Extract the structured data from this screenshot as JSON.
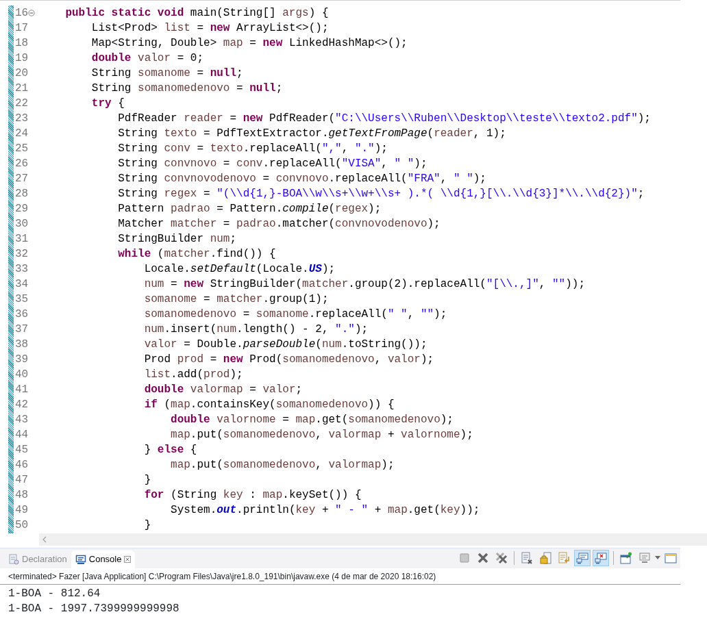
{
  "editor": {
    "lines": [
      {
        "number": "16",
        "fold": true,
        "tokens": [
          {
            "kind": "keyword",
            "text": "    public static void"
          },
          {
            "kind": "plain",
            "text": " main(String[] "
          },
          {
            "kind": "local",
            "text": "args"
          },
          {
            "kind": "plain",
            "text": ") {"
          }
        ]
      },
      {
        "number": "17",
        "fold": false,
        "tokens": [
          {
            "kind": "plain",
            "text": "        List<Prod> "
          },
          {
            "kind": "local",
            "text": "list"
          },
          {
            "kind": "plain",
            "text": " = "
          },
          {
            "kind": "keyword",
            "text": "new"
          },
          {
            "kind": "plain",
            "text": " ArrayList<>();"
          }
        ]
      },
      {
        "number": "18",
        "fold": false,
        "tokens": [
          {
            "kind": "plain",
            "text": "        Map<String, Double> "
          },
          {
            "kind": "local",
            "text": "map"
          },
          {
            "kind": "plain",
            "text": " = "
          },
          {
            "kind": "keyword",
            "text": "new"
          },
          {
            "kind": "plain",
            "text": " LinkedHashMap<>();"
          }
        ]
      },
      {
        "number": "19",
        "fold": false,
        "tokens": [
          {
            "kind": "keyword",
            "text": "        double "
          },
          {
            "kind": "local",
            "text": "valor"
          },
          {
            "kind": "plain",
            "text": " = 0;"
          }
        ]
      },
      {
        "number": "20",
        "fold": false,
        "tokens": [
          {
            "kind": "plain",
            "text": "        String "
          },
          {
            "kind": "local",
            "text": "somanome"
          },
          {
            "kind": "plain",
            "text": " = "
          },
          {
            "kind": "keyword",
            "text": "null"
          },
          {
            "kind": "plain",
            "text": ";"
          }
        ]
      },
      {
        "number": "21",
        "fold": false,
        "tokens": [
          {
            "kind": "plain",
            "text": "        String "
          },
          {
            "kind": "local",
            "text": "somanomedenovo"
          },
          {
            "kind": "plain",
            "text": " = "
          },
          {
            "kind": "keyword",
            "text": "null"
          },
          {
            "kind": "plain",
            "text": ";"
          }
        ]
      },
      {
        "number": "22",
        "fold": false,
        "tokens": [
          {
            "kind": "keyword",
            "text": "        try"
          },
          {
            "kind": "plain",
            "text": " {"
          }
        ]
      },
      {
        "number": "23",
        "fold": false,
        "tokens": [
          {
            "kind": "plain",
            "text": "            PdfReader "
          },
          {
            "kind": "local",
            "text": "reader"
          },
          {
            "kind": "plain",
            "text": " = "
          },
          {
            "kind": "keyword",
            "text": "new"
          },
          {
            "kind": "plain",
            "text": " PdfReader("
          },
          {
            "kind": "string",
            "text": "\"C:\\\\Users\\\\Ruben\\\\Desktop\\\\teste\\\\texto2.pdf\""
          },
          {
            "kind": "plain",
            "text": ");"
          }
        ]
      },
      {
        "number": "24",
        "fold": false,
        "tokens": [
          {
            "kind": "plain",
            "text": "            String "
          },
          {
            "kind": "local",
            "text": "texto"
          },
          {
            "kind": "plain",
            "text": " = PdfTextExtractor."
          },
          {
            "kind": "static",
            "text": "getTextFromPage"
          },
          {
            "kind": "plain",
            "text": "("
          },
          {
            "kind": "local",
            "text": "reader"
          },
          {
            "kind": "plain",
            "text": ", 1);"
          }
        ]
      },
      {
        "number": "25",
        "fold": false,
        "tokens": [
          {
            "kind": "plain",
            "text": "            String "
          },
          {
            "kind": "local",
            "text": "conv"
          },
          {
            "kind": "plain",
            "text": " = "
          },
          {
            "kind": "local",
            "text": "texto"
          },
          {
            "kind": "plain",
            "text": ".replaceAll("
          },
          {
            "kind": "string",
            "text": "\",\""
          },
          {
            "kind": "plain",
            "text": ", "
          },
          {
            "kind": "string",
            "text": "\".\""
          },
          {
            "kind": "plain",
            "text": ");"
          }
        ]
      },
      {
        "number": "26",
        "fold": false,
        "tokens": [
          {
            "kind": "plain",
            "text": "            String "
          },
          {
            "kind": "local",
            "text": "convnovo"
          },
          {
            "kind": "plain",
            "text": " = "
          },
          {
            "kind": "local",
            "text": "conv"
          },
          {
            "kind": "plain",
            "text": ".replaceAll("
          },
          {
            "kind": "string",
            "text": "\"VISA\""
          },
          {
            "kind": "plain",
            "text": ", "
          },
          {
            "kind": "string",
            "text": "\" \""
          },
          {
            "kind": "plain",
            "text": ");"
          }
        ]
      },
      {
        "number": "27",
        "fold": false,
        "tokens": [
          {
            "kind": "plain",
            "text": "            String "
          },
          {
            "kind": "local",
            "text": "convnovodenovo"
          },
          {
            "kind": "plain",
            "text": " = "
          },
          {
            "kind": "local",
            "text": "convnovo"
          },
          {
            "kind": "plain",
            "text": ".replaceAll("
          },
          {
            "kind": "string",
            "text": "\"FRA\""
          },
          {
            "kind": "plain",
            "text": ", "
          },
          {
            "kind": "string",
            "text": "\" \""
          },
          {
            "kind": "plain",
            "text": ");"
          }
        ]
      },
      {
        "number": "28",
        "fold": false,
        "tokens": [
          {
            "kind": "plain",
            "text": "            String "
          },
          {
            "kind": "local",
            "text": "regex"
          },
          {
            "kind": "plain",
            "text": " = "
          },
          {
            "kind": "string",
            "text": "\"(\\\\d{1,}-BOA\\\\w\\\\s+\\\\w+\\\\s+ ).*( \\\\d{1,}[\\\\.\\\\d{3}]*\\\\.\\\\d{2})\""
          },
          {
            "kind": "plain",
            "text": ";"
          }
        ]
      },
      {
        "number": "29",
        "fold": false,
        "tokens": [
          {
            "kind": "plain",
            "text": "            Pattern "
          },
          {
            "kind": "local",
            "text": "padrao"
          },
          {
            "kind": "plain",
            "text": " = Pattern."
          },
          {
            "kind": "static",
            "text": "compile"
          },
          {
            "kind": "plain",
            "text": "("
          },
          {
            "kind": "local",
            "text": "regex"
          },
          {
            "kind": "plain",
            "text": ");"
          }
        ]
      },
      {
        "number": "30",
        "fold": false,
        "tokens": [
          {
            "kind": "plain",
            "text": "            Matcher "
          },
          {
            "kind": "local",
            "text": "matcher"
          },
          {
            "kind": "plain",
            "text": " = "
          },
          {
            "kind": "local",
            "text": "padrao"
          },
          {
            "kind": "plain",
            "text": ".matcher("
          },
          {
            "kind": "local",
            "text": "convnovodenovo"
          },
          {
            "kind": "plain",
            "text": ");"
          }
        ]
      },
      {
        "number": "31",
        "fold": false,
        "tokens": [
          {
            "kind": "plain",
            "text": "            StringBuilder "
          },
          {
            "kind": "local",
            "text": "num"
          },
          {
            "kind": "plain",
            "text": ";"
          }
        ]
      },
      {
        "number": "32",
        "fold": false,
        "tokens": [
          {
            "kind": "keyword",
            "text": "            while"
          },
          {
            "kind": "plain",
            "text": " ("
          },
          {
            "kind": "local",
            "text": "matcher"
          },
          {
            "kind": "plain",
            "text": ".find()) {"
          }
        ]
      },
      {
        "number": "33",
        "fold": false,
        "tokens": [
          {
            "kind": "plain",
            "text": "                Locale."
          },
          {
            "kind": "static",
            "text": "setDefault"
          },
          {
            "kind": "plain",
            "text": "(Locale."
          },
          {
            "kind": "field",
            "text": "US"
          },
          {
            "kind": "plain",
            "text": ");"
          }
        ]
      },
      {
        "number": "34",
        "fold": false,
        "tokens": [
          {
            "kind": "local",
            "text": "                num"
          },
          {
            "kind": "plain",
            "text": " = "
          },
          {
            "kind": "keyword",
            "text": "new"
          },
          {
            "kind": "plain",
            "text": " StringBuilder("
          },
          {
            "kind": "local",
            "text": "matcher"
          },
          {
            "kind": "plain",
            "text": ".group(2).replaceAll("
          },
          {
            "kind": "string",
            "text": "\"[\\\\.,]\""
          },
          {
            "kind": "plain",
            "text": ", "
          },
          {
            "kind": "string",
            "text": "\"\""
          },
          {
            "kind": "plain",
            "text": "));"
          }
        ]
      },
      {
        "number": "35",
        "fold": false,
        "tokens": [
          {
            "kind": "local",
            "text": "                somanome"
          },
          {
            "kind": "plain",
            "text": " = "
          },
          {
            "kind": "local",
            "text": "matcher"
          },
          {
            "kind": "plain",
            "text": ".group(1);"
          }
        ]
      },
      {
        "number": "36",
        "fold": false,
        "tokens": [
          {
            "kind": "local",
            "text": "                somanomedenovo"
          },
          {
            "kind": "plain",
            "text": " = "
          },
          {
            "kind": "local",
            "text": "somanome"
          },
          {
            "kind": "plain",
            "text": ".replaceAll("
          },
          {
            "kind": "string",
            "text": "\" \""
          },
          {
            "kind": "plain",
            "text": ", "
          },
          {
            "kind": "string",
            "text": "\"\""
          },
          {
            "kind": "plain",
            "text": ");"
          }
        ]
      },
      {
        "number": "37",
        "fold": false,
        "tokens": [
          {
            "kind": "local",
            "text": "                num"
          },
          {
            "kind": "plain",
            "text": ".insert("
          },
          {
            "kind": "local",
            "text": "num"
          },
          {
            "kind": "plain",
            "text": ".length() - 2, "
          },
          {
            "kind": "string",
            "text": "\".\""
          },
          {
            "kind": "plain",
            "text": ");"
          }
        ]
      },
      {
        "number": "38",
        "fold": false,
        "tokens": [
          {
            "kind": "local",
            "text": "                valor"
          },
          {
            "kind": "plain",
            "text": " = Double."
          },
          {
            "kind": "static",
            "text": "parseDouble"
          },
          {
            "kind": "plain",
            "text": "("
          },
          {
            "kind": "local",
            "text": "num"
          },
          {
            "kind": "plain",
            "text": ".toString());"
          }
        ]
      },
      {
        "number": "39",
        "fold": false,
        "tokens": [
          {
            "kind": "plain",
            "text": "                Prod "
          },
          {
            "kind": "local",
            "text": "prod"
          },
          {
            "kind": "plain",
            "text": " = "
          },
          {
            "kind": "keyword",
            "text": "new"
          },
          {
            "kind": "plain",
            "text": " Prod("
          },
          {
            "kind": "local",
            "text": "somanomedenovo"
          },
          {
            "kind": "plain",
            "text": ", "
          },
          {
            "kind": "local",
            "text": "valor"
          },
          {
            "kind": "plain",
            "text": ");"
          }
        ]
      },
      {
        "number": "40",
        "fold": false,
        "tokens": [
          {
            "kind": "local",
            "text": "                list"
          },
          {
            "kind": "plain",
            "text": ".add("
          },
          {
            "kind": "local",
            "text": "prod"
          },
          {
            "kind": "plain",
            "text": ");"
          }
        ]
      },
      {
        "number": "41",
        "fold": false,
        "tokens": [
          {
            "kind": "keyword",
            "text": "                double "
          },
          {
            "kind": "local",
            "text": "valormap"
          },
          {
            "kind": "plain",
            "text": " = "
          },
          {
            "kind": "local",
            "text": "valor"
          },
          {
            "kind": "plain",
            "text": ";"
          }
        ]
      },
      {
        "number": "42",
        "fold": false,
        "tokens": [
          {
            "kind": "keyword",
            "text": "                if"
          },
          {
            "kind": "plain",
            "text": " ("
          },
          {
            "kind": "local",
            "text": "map"
          },
          {
            "kind": "plain",
            "text": ".containsKey("
          },
          {
            "kind": "local",
            "text": "somanomedenovo"
          },
          {
            "kind": "plain",
            "text": ")) {"
          }
        ]
      },
      {
        "number": "43",
        "fold": false,
        "tokens": [
          {
            "kind": "keyword",
            "text": "                    double "
          },
          {
            "kind": "local",
            "text": "valornome"
          },
          {
            "kind": "plain",
            "text": " = "
          },
          {
            "kind": "local",
            "text": "map"
          },
          {
            "kind": "plain",
            "text": ".get("
          },
          {
            "kind": "local",
            "text": "somanomedenovo"
          },
          {
            "kind": "plain",
            "text": ");"
          }
        ]
      },
      {
        "number": "44",
        "fold": false,
        "tokens": [
          {
            "kind": "local",
            "text": "                    map"
          },
          {
            "kind": "plain",
            "text": ".put("
          },
          {
            "kind": "local",
            "text": "somanomedenovo"
          },
          {
            "kind": "plain",
            "text": ", "
          },
          {
            "kind": "local",
            "text": "valormap"
          },
          {
            "kind": "plain",
            "text": " + "
          },
          {
            "kind": "local",
            "text": "valornome"
          },
          {
            "kind": "plain",
            "text": ");"
          }
        ]
      },
      {
        "number": "45",
        "fold": false,
        "tokens": [
          {
            "kind": "plain",
            "text": "                } "
          },
          {
            "kind": "keyword",
            "text": "else"
          },
          {
            "kind": "plain",
            "text": " {"
          }
        ]
      },
      {
        "number": "46",
        "fold": false,
        "tokens": [
          {
            "kind": "local",
            "text": "                    map"
          },
          {
            "kind": "plain",
            "text": ".put("
          },
          {
            "kind": "local",
            "text": "somanomedenovo"
          },
          {
            "kind": "plain",
            "text": ", "
          },
          {
            "kind": "local",
            "text": "valormap"
          },
          {
            "kind": "plain",
            "text": ");"
          }
        ]
      },
      {
        "number": "47",
        "fold": false,
        "tokens": [
          {
            "kind": "plain",
            "text": "                }"
          }
        ]
      },
      {
        "number": "48",
        "fold": false,
        "tokens": [
          {
            "kind": "keyword",
            "text": "                for"
          },
          {
            "kind": "plain",
            "text": " (String "
          },
          {
            "kind": "local",
            "text": "key"
          },
          {
            "kind": "plain",
            "text": " : "
          },
          {
            "kind": "local",
            "text": "map"
          },
          {
            "kind": "plain",
            "text": ".keySet()) {"
          }
        ]
      },
      {
        "number": "49",
        "fold": false,
        "tokens": [
          {
            "kind": "plain",
            "text": "                    System."
          },
          {
            "kind": "field",
            "text": "out"
          },
          {
            "kind": "plain",
            "text": ".println("
          },
          {
            "kind": "local",
            "text": "key"
          },
          {
            "kind": "plain",
            "text": " + "
          },
          {
            "kind": "string",
            "text": "\" - \""
          },
          {
            "kind": "plain",
            "text": " + "
          },
          {
            "kind": "local",
            "text": "map"
          },
          {
            "kind": "plain",
            "text": ".get("
          },
          {
            "kind": "local",
            "text": "key"
          },
          {
            "kind": "plain",
            "text": "));"
          }
        ]
      },
      {
        "number": "50",
        "fold": false,
        "tokens": [
          {
            "kind": "plain",
            "text": "                }"
          }
        ]
      }
    ]
  },
  "panel": {
    "tabs": [
      {
        "kind": "declaration",
        "label": "Declaration",
        "selected": false,
        "closable": false
      },
      {
        "kind": "console",
        "label": "Console",
        "selected": true,
        "closable": true
      }
    ],
    "toolbar": [
      {
        "kind": "terminate",
        "on": false
      },
      {
        "kind": "remove",
        "on": false
      },
      {
        "kind": "remove-all",
        "on": false
      },
      {
        "kind": "separator"
      },
      {
        "kind": "clear",
        "on": false
      },
      {
        "kind": "scroll-lock",
        "on": false
      },
      {
        "kind": "word-wrap",
        "on": false
      },
      {
        "kind": "show-stdout",
        "on": true
      },
      {
        "kind": "show-stderr",
        "on": true
      },
      {
        "kind": "separator"
      },
      {
        "kind": "pin",
        "on": false
      },
      {
        "kind": "display",
        "on": false
      },
      {
        "kind": "open",
        "on": false
      }
    ],
    "status": "<terminated> Fazer [Java Application] C:\\Program Files\\Java\\jre1.8.0_191\\bin\\javaw.exe (4 de mar de 2020 18:16:02)",
    "output": [
      "1-BOA - 812.64",
      "1-BOA - 1997.7399999999998"
    ]
  }
}
